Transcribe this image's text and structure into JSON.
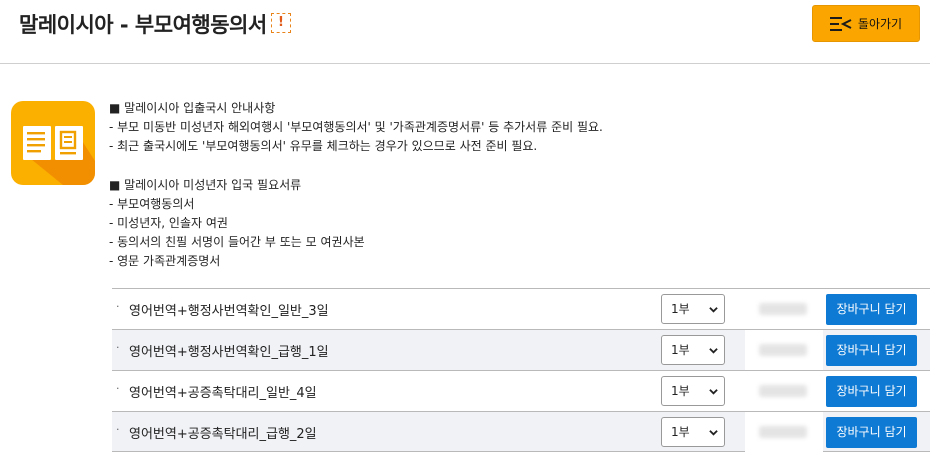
{
  "header": {
    "title": "말레이시아 - 부모여행동의서",
    "alert_icon_glyph": "!",
    "back_label": "돌아가기",
    "back_icon": "list-back-icon"
  },
  "colors": {
    "accent": "#fba600",
    "primary_button": "#0f7ad4",
    "icon_bg": "#fbb000"
  },
  "info": {
    "section1_title": "■ 말레이시아 입출국시 안내사항",
    "section1_lines": [
      "- 부모 미동반 미성년자 해외여행시 '부모여행동의서' 및 '가족관계증명서류' 등 추가서류 준비 필요.",
      "- 최근 출국시에도 '부모여행동의서' 유무를 체크하는 경우가 있으므로 사전 준비 필요."
    ],
    "section2_title": "■ 말레이시아 미성년자 입국 필요서류",
    "section2_lines": [
      "- 부모여행동의서",
      "- 미성년자, 인솔자 여권",
      "- 동의서의 친필 서명이 들어간 부 또는 모 여권사본",
      "- 영문 가족관계증명서"
    ]
  },
  "options": [
    {
      "bullet": "·",
      "name": "영어번역+행정사번역확인_일반_3일",
      "qty": "1부",
      "cart_label": "장바구니 담기"
    },
    {
      "bullet": "·",
      "name": "영어번역+행정사번역확인_급행_1일",
      "qty": "1부",
      "cart_label": "장바구니 담기"
    },
    {
      "bullet": "·",
      "name": "영어번역+공증촉탁대리_일반_4일",
      "qty": "1부",
      "cart_label": "장바구니 담기"
    },
    {
      "bullet": "·",
      "name": "영어번역+공증촉탁대리_급행_2일",
      "qty": "1부",
      "cart_label": "장바구니 담기"
    }
  ]
}
